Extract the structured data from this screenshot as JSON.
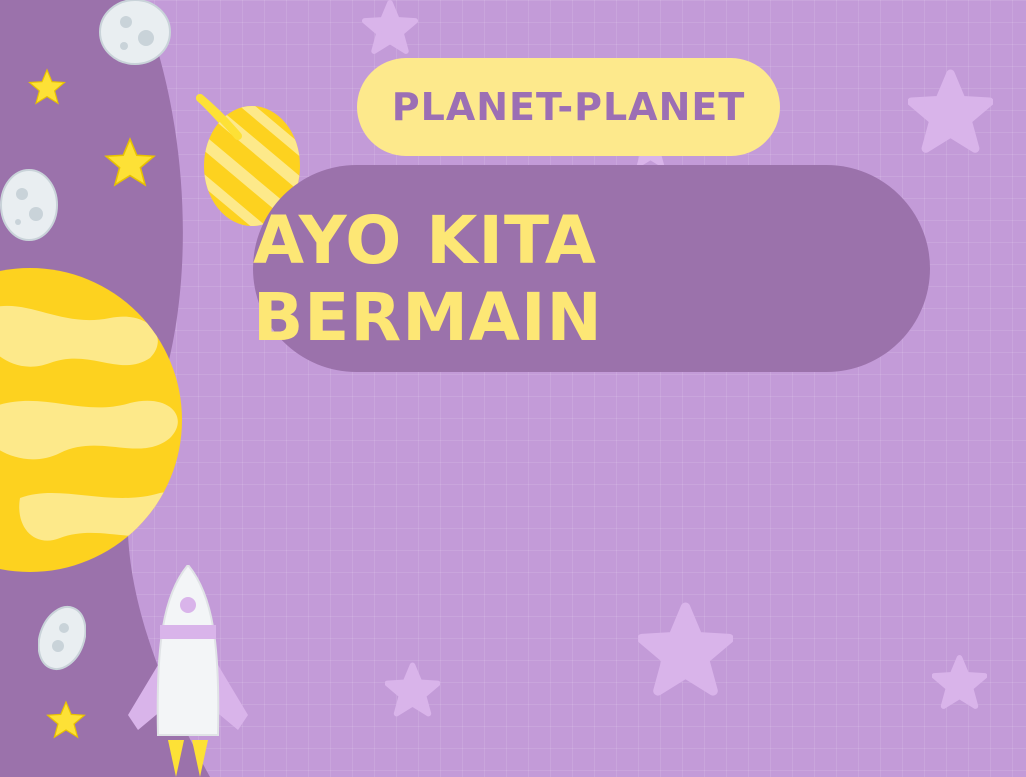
{
  "slide": {
    "subtitle": "PLANET-PLANET",
    "title": "AYO KITA BERMAIN"
  },
  "colors": {
    "background": "#c39bd8",
    "band": "#9b72ab",
    "yellow": "#fde775",
    "title_pill": "#fde98c",
    "title_text": "#9c6fb4",
    "star_light": "#d9b4ea"
  },
  "icons": [
    "star-icon",
    "asteroid-icon",
    "ringed-planet-icon",
    "planet-icon",
    "rocket-icon"
  ]
}
